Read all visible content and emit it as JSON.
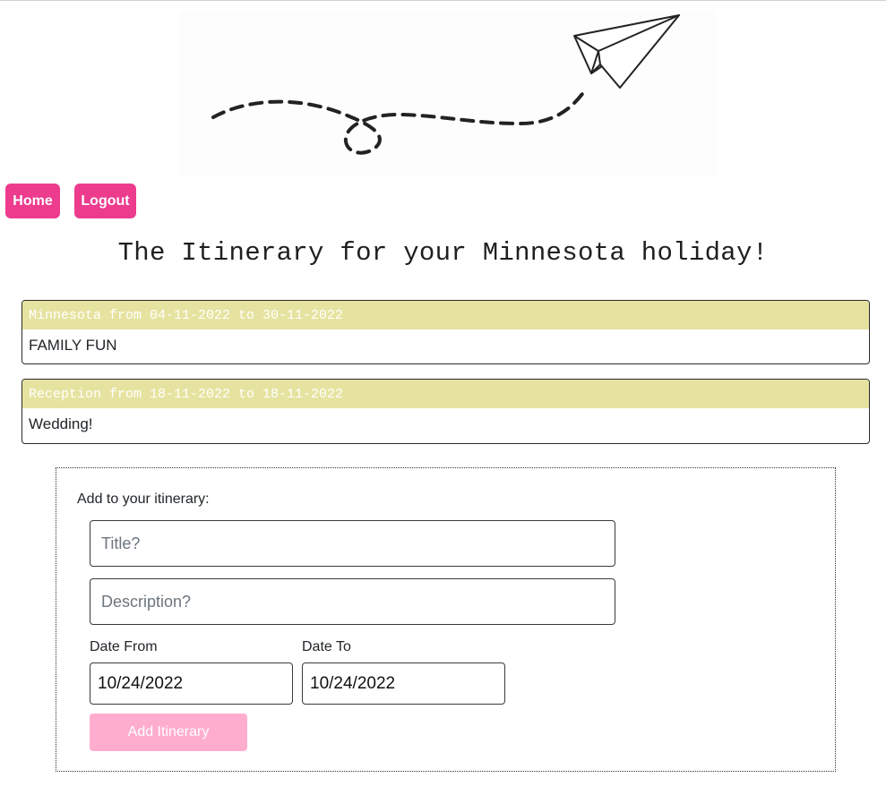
{
  "nav": {
    "home_label": "Home",
    "logout_label": "Logout"
  },
  "page": {
    "title": "The Itinerary for your Minnesota holiday!"
  },
  "itinerary": [
    {
      "header": "Minnesota from 04-11-2022 to 30-11-2022",
      "description": "FAMILY FUN"
    },
    {
      "header": "Reception from 18-11-2022 to 18-11-2022",
      "description": "Wedding!"
    }
  ],
  "form": {
    "heading": "Add to your itinerary:",
    "title_placeholder": "Title?",
    "description_placeholder": "Description?",
    "date_from_label": "Date From",
    "date_to_label": "Date To",
    "date_from_value": "10/24/2022",
    "date_to_value": "10/24/2022",
    "submit_label": "Add Itinerary"
  },
  "colors": {
    "nav_button": "#ed3b8e",
    "card_header": "#e6e3a0",
    "submit_disabled": "#ffadcf"
  },
  "icons": {
    "hero": "paper-plane-icon"
  }
}
